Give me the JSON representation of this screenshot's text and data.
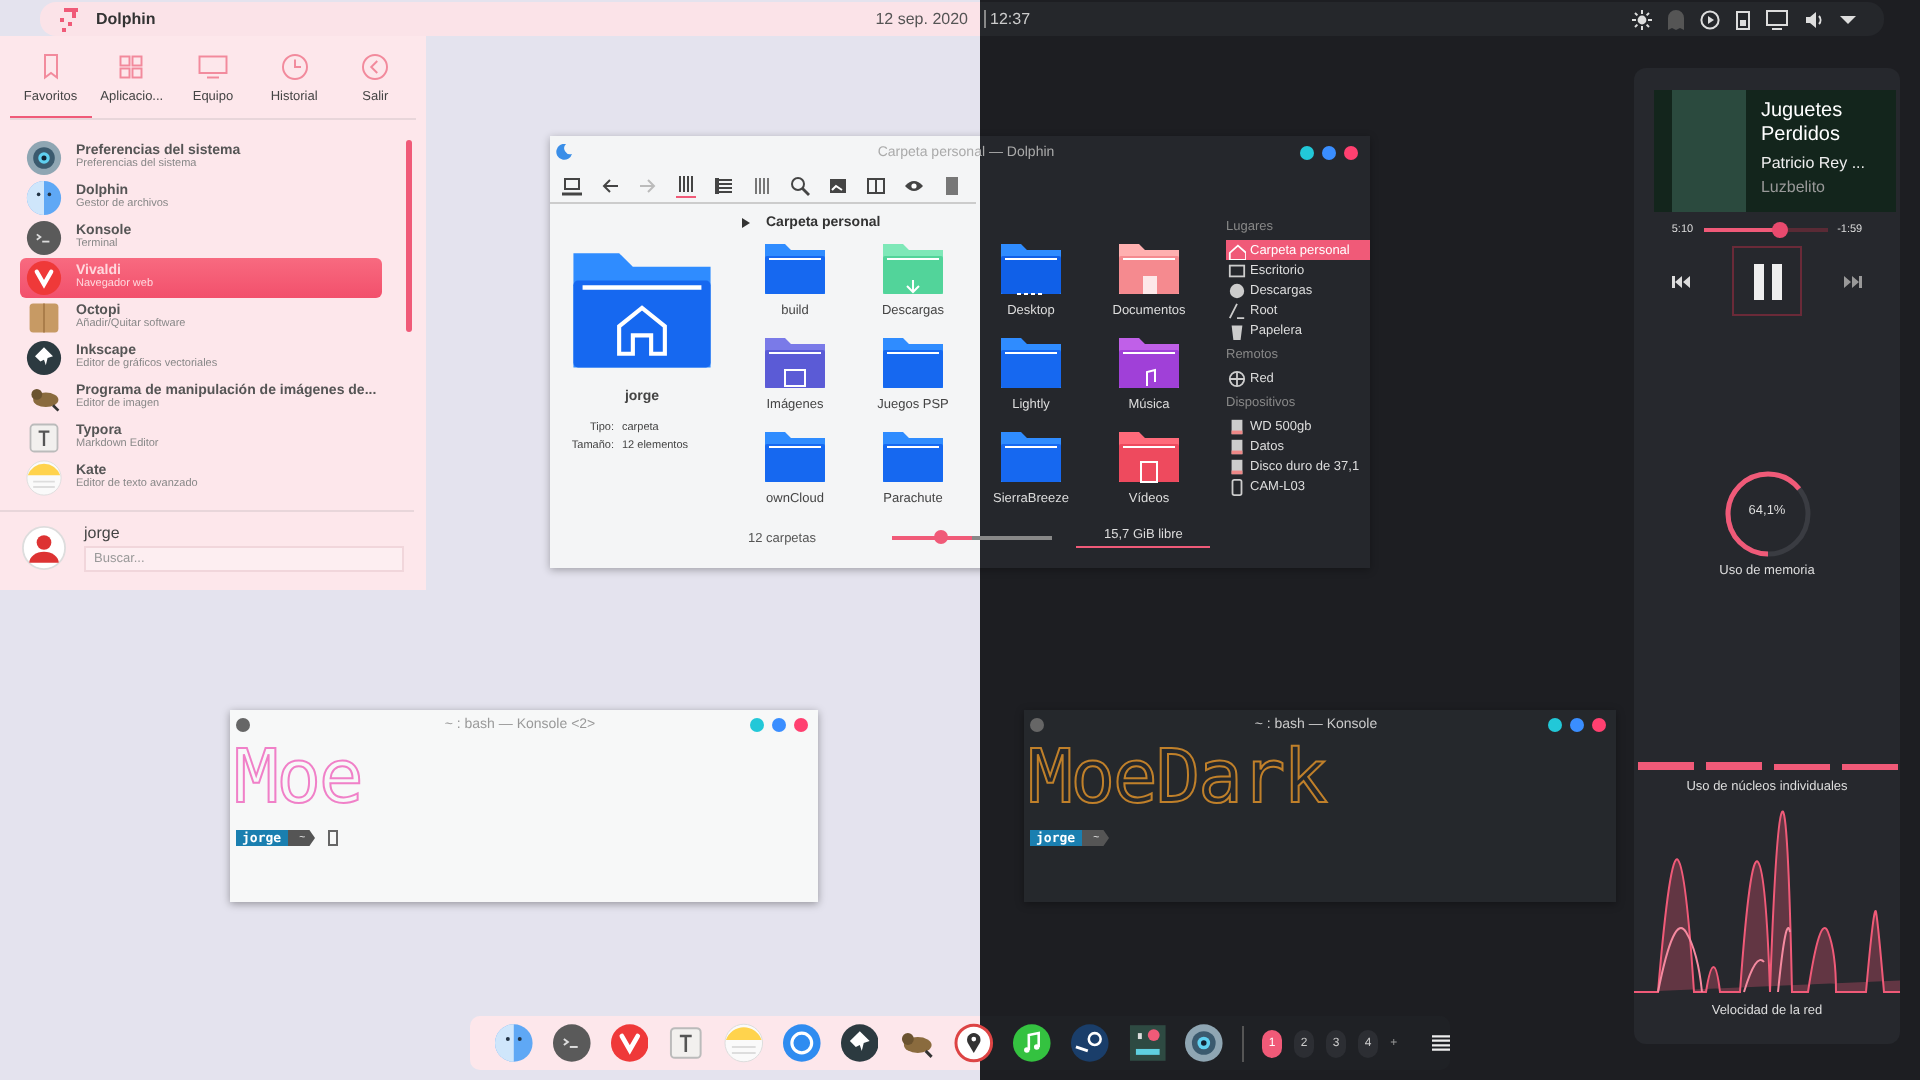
{
  "top_bar": {
    "app": "Dolphin",
    "date": "12 sep. 2020",
    "time": "12:37"
  },
  "menu": {
    "tabs": [
      {
        "label": "Favoritos",
        "kind": "bookmark",
        "selected": true
      },
      {
        "label": "Aplicacio...",
        "kind": "grid",
        "selected": false
      },
      {
        "label": "Equipo",
        "kind": "monitor",
        "selected": false
      },
      {
        "label": "Historial",
        "kind": "clock",
        "selected": false
      },
      {
        "label": "Salir",
        "kind": "leave",
        "selected": false
      }
    ],
    "items": [
      {
        "name": "Preferencias del sistema",
        "description": "Preferencias del sistema",
        "kind": "eye",
        "selected": false
      },
      {
        "name": "Dolphin",
        "description": "Gestor de archivos",
        "kind": "finder",
        "selected": false
      },
      {
        "name": "Konsole",
        "description": "Terminal",
        "kind": "terminal",
        "selected": false
      },
      {
        "name": "Vivaldi",
        "description": "Navegador web",
        "kind": "vivaldi",
        "selected": true
      },
      {
        "name": "Octopi",
        "description": "Añadir/Quitar software",
        "kind": "box",
        "selected": false
      },
      {
        "name": "Inkscape",
        "description": "Editor de gráficos vectoriales",
        "kind": "inkscape",
        "selected": false
      },
      {
        "name": "Programa de manipulación de imágenes de...",
        "description": "Editor de imagen",
        "kind": "gimp",
        "selected": false
      },
      {
        "name": "Typora",
        "description": "Markdown Editor",
        "kind": "typora",
        "selected": false
      },
      {
        "name": "Kate",
        "description": "Editor de texto avanzado",
        "kind": "notes",
        "selected": false
      }
    ],
    "user": "jorge",
    "search": {
      "placeholder": "Buscar..."
    }
  },
  "dolphin": {
    "title": "Carpeta personal — Dolphin",
    "breadcrumb": "Carpeta personal",
    "info": {
      "name": "jorge",
      "rows": [
        {
          "label": "Tipo:",
          "value": "carpeta"
        },
        {
          "label": "Tamaño:",
          "value": "12 elementos"
        }
      ]
    },
    "folders": [
      {
        "name": "build",
        "kind": "plain"
      },
      {
        "name": "Descargas",
        "kind": "downloads"
      },
      {
        "name": "Desktop",
        "kind": "desktop"
      },
      {
        "name": "Documentos",
        "kind": "documents"
      },
      {
        "name": "Imágenes",
        "kind": "images"
      },
      {
        "name": "Juegos PSP",
        "kind": "plain"
      },
      {
        "name": "Lightly",
        "kind": "plain"
      },
      {
        "name": "Música",
        "kind": "music"
      },
      {
        "name": "ownCloud",
        "kind": "plain"
      },
      {
        "name": "Parachute",
        "kind": "plain"
      },
      {
        "name": "SierraBreeze",
        "kind": "plain"
      },
      {
        "name": "Vídeos",
        "kind": "videos"
      }
    ],
    "places": [
      {
        "title": "Lugares",
        "items": [
          {
            "label": "Carpeta personal",
            "kind": "home",
            "selected": true
          },
          {
            "label": "Escritorio",
            "kind": "desktop",
            "selected": false
          },
          {
            "label": "Descargas",
            "kind": "download",
            "selected": false
          },
          {
            "label": "Root",
            "kind": "root",
            "selected": false
          },
          {
            "label": "Papelera",
            "kind": "trash",
            "selected": false
          }
        ]
      },
      {
        "title": "Remotos",
        "items": [
          {
            "label": "Red",
            "kind": "network",
            "selected": false
          }
        ]
      },
      {
        "title": "Dispositivos",
        "items": [
          {
            "label": "WD 500gb",
            "kind": "drive",
            "selected": false
          },
          {
            "label": "Datos",
            "kind": "drive",
            "selected": false
          },
          {
            "label": "Disco duro de 37,1",
            "kind": "drive",
            "selected": false
          },
          {
            "label": "CAM-L03",
            "kind": "phone",
            "selected": false
          }
        ]
      }
    ],
    "status": "12 carpetas",
    "zoom": {
      "level": 0.3
    },
    "free": "15,7 GiB libre"
  },
  "konsoles": [
    {
      "title": "~ : bash — Konsole <2>",
      "banner": "Moe",
      "user": "jorge",
      "path": "~",
      "dark": false
    },
    {
      "title": "~ : bash — Konsole",
      "banner": "MoeDark",
      "user": "jorge",
      "path": "~",
      "dark": true
    }
  ],
  "player": {
    "title": "Juguetes Perdidos",
    "artist": "Patricio Rey ...",
    "album": "Luzbelito",
    "elapsed": "5:10",
    "remaining": "-1:59",
    "level": 0.62,
    "playing": true
  },
  "memory": {
    "reading": "64,1%",
    "level": 0.641,
    "label": "Uso de memoria"
  },
  "cores": {
    "label": "Uso de núcleos individuales"
  },
  "network": {
    "label": "Velocidad de la red"
  },
  "dock": {
    "apps": [
      {
        "kind": "finder"
      },
      {
        "kind": "terminal"
      },
      {
        "kind": "vivaldi"
      },
      {
        "kind": "typora"
      },
      {
        "kind": "notes"
      },
      {
        "kind": "torrent"
      },
      {
        "kind": "inkscape"
      },
      {
        "kind": "gimp"
      },
      {
        "kind": "maps"
      },
      {
        "kind": "music"
      },
      {
        "kind": "steam"
      },
      {
        "kind": "mixer"
      },
      {
        "kind": "eye"
      }
    ],
    "desktops": [
      {
        "label": "1",
        "selected": true
      },
      {
        "label": "2",
        "selected": false
      },
      {
        "label": "3",
        "selected": false
      },
      {
        "label": "4",
        "selected": false
      }
    ],
    "add": "+"
  }
}
